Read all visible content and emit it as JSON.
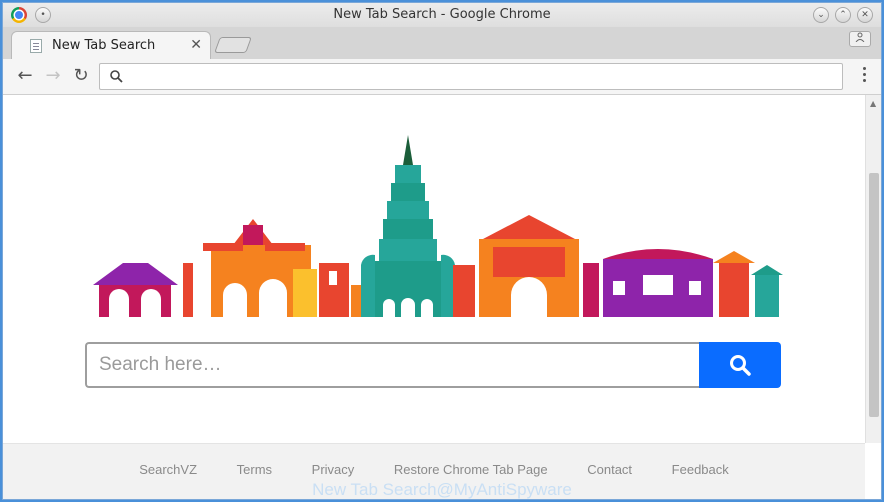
{
  "window": {
    "title": "New Tab Search - Google Chrome"
  },
  "tab": {
    "label": "New Tab Search",
    "close_glyph": "✕"
  },
  "toolbar": {
    "back_glyph": "←",
    "forward_glyph": "→",
    "reload_glyph": "↻",
    "address_value": "",
    "address_placeholder": ""
  },
  "search": {
    "placeholder": "Search here…"
  },
  "footer": {
    "links": [
      "SearchVZ",
      "Terms",
      "Privacy",
      "Restore Chrome Tab Page",
      "Contact",
      "Feedback"
    ]
  },
  "watermark": "New Tab Search@MyAntiSpyware",
  "colors": {
    "search_button": "#0a6cff",
    "skyline": [
      "#e8452f",
      "#f5821f",
      "#c2185b",
      "#8e24aa",
      "#26a69a",
      "#fbc02d"
    ]
  },
  "icons": {
    "search_button": "magnifier-icon",
    "omnibox": "search-icon"
  }
}
